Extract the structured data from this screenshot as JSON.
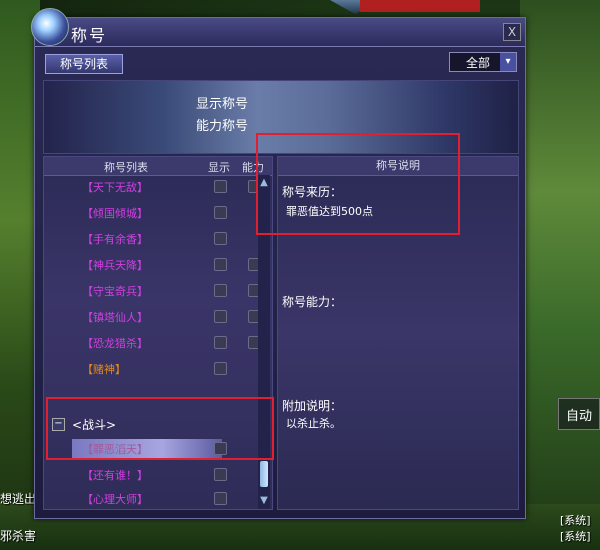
{
  "window": {
    "title": "称号",
    "close_label": "X"
  },
  "tabs": {
    "title_list_tab": "称号列表"
  },
  "filter": {
    "selected": "全部",
    "arrow": "▾"
  },
  "banner": {
    "line1": "显示称号",
    "line2": "能力称号"
  },
  "list": {
    "headers": {
      "name": "称号列表",
      "show": "显示",
      "ability": "能力"
    },
    "rows": [
      {
        "name": "【天下无敌】",
        "color": "pink"
      },
      {
        "name": "【倾国倾城】",
        "color": "pink"
      },
      {
        "name": "【手有余香】",
        "color": "pink"
      },
      {
        "name": "【神兵天降】",
        "color": "pink"
      },
      {
        "name": "【守宝奇兵】",
        "color": "pink"
      },
      {
        "name": "【镇塔仙人】",
        "color": "pink"
      },
      {
        "name": "【恐龙猎杀】",
        "color": "pink"
      },
      {
        "name": "【赌神】",
        "color": "orange"
      }
    ],
    "group": {
      "toggle": "−",
      "label": "<战斗>"
    },
    "selected_item": "【罪恶滔天】",
    "after_rows": [
      {
        "name": "【还有谁！】",
        "color": "pink"
      },
      {
        "name": "【心理大师】",
        "color": "pink"
      }
    ],
    "scroll_up": "▲",
    "scroll_down": "▼"
  },
  "detail": {
    "header": "称号说明",
    "origin_label": "称号来历：",
    "origin_value": "罪恶值达到500点",
    "ability_label": "称号能力：",
    "extra_label": "附加说明：",
    "extra_value": "以杀止杀。"
  },
  "background": {
    "left_text_1": "想逃出",
    "left_text_2": "邪杀害",
    "auto_button": "自动",
    "right_text_1": "[系统]",
    "right_text_2": "[系统]"
  },
  "colors": {
    "highlight_box": "#e02030",
    "pink_title": "#d040e0",
    "orange_title": "#e08a20"
  }
}
